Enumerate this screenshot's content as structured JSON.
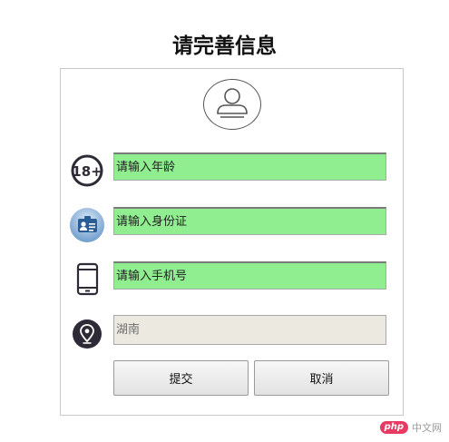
{
  "page": {
    "title": "请完善信息"
  },
  "form": {
    "avatar_icon": "user-avatar-icon",
    "fields": [
      {
        "icon": "age-18-plus-icon",
        "placeholder": "请输入年龄",
        "value": ""
      },
      {
        "icon": "id-card-icon",
        "placeholder": "请输入身份证",
        "value": ""
      },
      {
        "icon": "tablet-phone-icon",
        "placeholder": "请输入手机号",
        "value": ""
      },
      {
        "icon": "location-pin-icon",
        "selected": "湖南"
      }
    ],
    "submit_label": "提交",
    "cancel_label": "取消"
  },
  "watermark": {
    "badge": "php",
    "text": "中文网"
  },
  "colors": {
    "input_bg": "#90ee90",
    "select_bg": "#ebe9e0",
    "watermark_badge": "#e83a62"
  }
}
